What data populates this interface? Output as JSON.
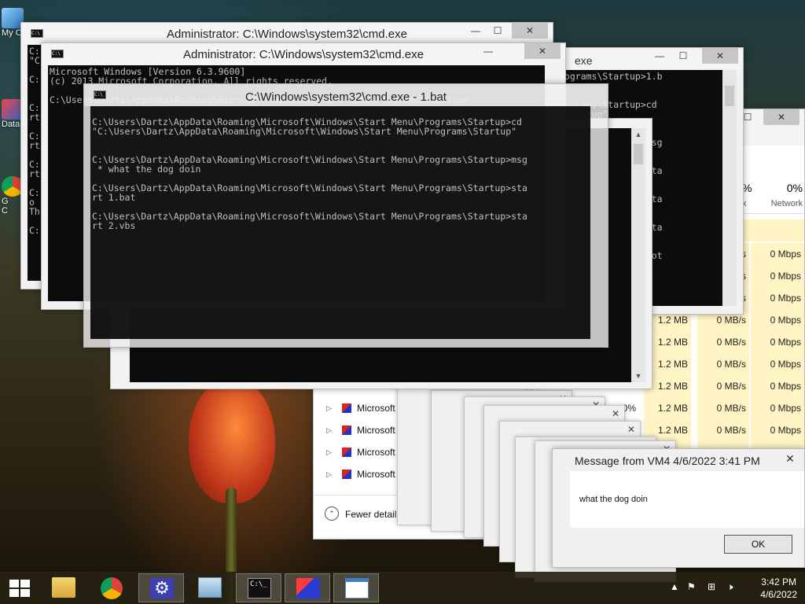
{
  "desktop_icons": [
    {
      "label": "My C"
    },
    {
      "label": "Data"
    },
    {
      "label": "G"
    },
    {
      "label": "C"
    }
  ],
  "cmd_windows": {
    "back": {
      "title": "Administrator: C:\\Windows\\system32\\cmd.exe",
      "lines": "C:\n\"C\n\nC:\n \n\nC:\nrt\n\nC:\nrt\n\nC:\nrt\n\nC:\no\nTh\n\nC:"
    },
    "middle": {
      "title": "Administrator: C:\\Windows\\system32\\cmd.exe",
      "lines": "Microsoft Windows [Version 6.3.9600]\n(c) 2013 Microsoft Corporation. All rights reserved.\n\nC:\\Users\\Dartz\\AppData\\Roaming\\Microsoft\\Windows\\Start Menu\\Programs\\Startup>"
    },
    "right_partial": {
      "title": "exe",
      "lines": "rograms\\Startup>1.b\n\n\nrograms\\Startup>cd\n\\Startup\"\n\n\nrograms\\Startup>msg\n\n\nrograms\\Startup>sta\n\n\nrograms\\Startup>sta\n\n\nrograms\\Startup>sta\n\n\nrograms\\Startup>got\n\n\nrograms\\Startup>"
    },
    "front": {
      "title": "C:\\Windows\\system32\\cmd.exe - 1.bat",
      "lines": "\nC:\\Users\\Dartz\\AppData\\Roaming\\Microsoft\\Windows\\Start Menu\\Programs\\Startup>cd\n\"C:\\Users\\Dartz\\AppData\\Roaming\\Microsoft\\Windows\\Start Menu\\Programs\\Startup\"\n\n\nC:\\Users\\Dartz\\AppData\\Roaming\\Microsoft\\Windows\\Start Menu\\Programs\\Startup>msg\n * what the dog doin\n\nC:\\Users\\Dartz\\AppData\\Roaming\\Microsoft\\Windows\\Start Menu\\Programs\\Startup>sta\nrt 1.bat\n\nC:\\Users\\Dartz\\AppData\\Roaming\\Microsoft\\Windows\\Start Menu\\Programs\\Startup>sta\nrt 2.vbs"
    }
  },
  "task_manager": {
    "header": {
      "disk_pct": "%",
      "network_pct": "0%",
      "disk_label": "k",
      "network_label": "Network"
    },
    "rows": [
      {
        "name": "",
        "memory": "",
        "disk": "s",
        "network": "0 Mbps"
      },
      {
        "name": "",
        "memory": "",
        "disk": "s",
        "network": "0 Mbps"
      },
      {
        "name": "",
        "memory": "",
        "disk": "s",
        "network": "0 Mbps"
      },
      {
        "name": "",
        "memory": "1.2 MB",
        "disk": "0 MB/s",
        "network": "0 Mbps"
      },
      {
        "name": "",
        "memory": "1.2 MB",
        "disk": "0 MB/s",
        "network": "0 Mbps"
      },
      {
        "name": "",
        "memory": "1.2 MB",
        "disk": "0 MB/s",
        "network": "0 Mbps"
      },
      {
        "name": "",
        "memory": "1.2 MB",
        "disk": "0 MB/s",
        "network": "0 Mbps"
      },
      {
        "name": "Microsoft",
        "memory": "1.2 MB",
        "disk": "0 MB/s",
        "network": "0 Mbps",
        "cpu": "0%"
      },
      {
        "name": "Microsoft ® W",
        "memory": "1.2 MB",
        "disk": "0 MB/s",
        "network": "0 Mbps"
      },
      {
        "name": "Microsoft ® Wind",
        "memory": "",
        "disk": "",
        "network": ""
      },
      {
        "name": "Microsoft ® Windows Bu",
        "memory": "",
        "disk": "",
        "network": ""
      }
    ],
    "fewer_details": "Fewer details"
  },
  "message_box": {
    "title": "Message from VM4 4/6/2022 3:41 PM",
    "text": "what the dog doin",
    "ok_label": "OK",
    "close_glyph": "✕"
  },
  "window_controls": {
    "minimize": "—",
    "maximize": "☐",
    "close": "✕"
  },
  "taskbar": {
    "items": [
      {
        "name": "file-explorer"
      },
      {
        "name": "chrome"
      },
      {
        "name": "settings",
        "active": true
      },
      {
        "name": "task-manager"
      },
      {
        "name": "command-prompt",
        "active": true
      },
      {
        "name": "batch-app",
        "active": true
      },
      {
        "name": "notepad",
        "active": true
      }
    ],
    "time": "3:42 PM",
    "date": "4/6/2022"
  }
}
